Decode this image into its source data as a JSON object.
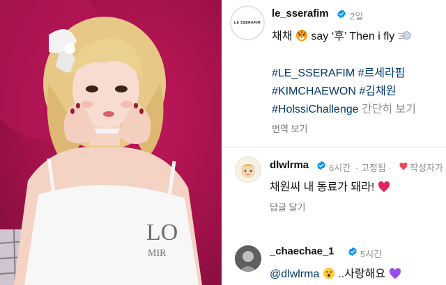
{
  "post": {
    "username": "le_sserafim",
    "avatar_text": "LE SSERAFIM",
    "time": "2일",
    "caption_word": "채채",
    "caption_rest": "say ‘후’ Then i fly",
    "hashtags": [
      "#LE_SSERAFIM",
      "#르세라핌",
      "#KIMCHAEWON",
      "#김채원",
      "#HolssiChallenge"
    ],
    "more_label": "간단히 보기",
    "translate_label": "번역 보기"
  },
  "comments": [
    {
      "username": "dlwlrma",
      "time": "6시간",
      "pinned_label": "· 고정됨 ·",
      "author_badge": "작성자가",
      "text": "채원씨 내 동료가 돼라!",
      "reply_label": "답글 달기"
    },
    {
      "username": "_chaechae_1",
      "time": "5시간",
      "mention": "@dlwlrma",
      "text": "..사랑해요"
    }
  ],
  "colors": {
    "photo_bg": "#a3124a",
    "hashtag": "#00376b",
    "verified": "#0095f6",
    "heart": "#ed4956",
    "purple_heart": "#9b4dea"
  },
  "icons": [
    "verified-icon",
    "tiger-emoji-icon",
    "dash-emoji-icon",
    "heart-icon",
    "hushed-face-emoji-icon",
    "purple-heart-icon"
  ]
}
